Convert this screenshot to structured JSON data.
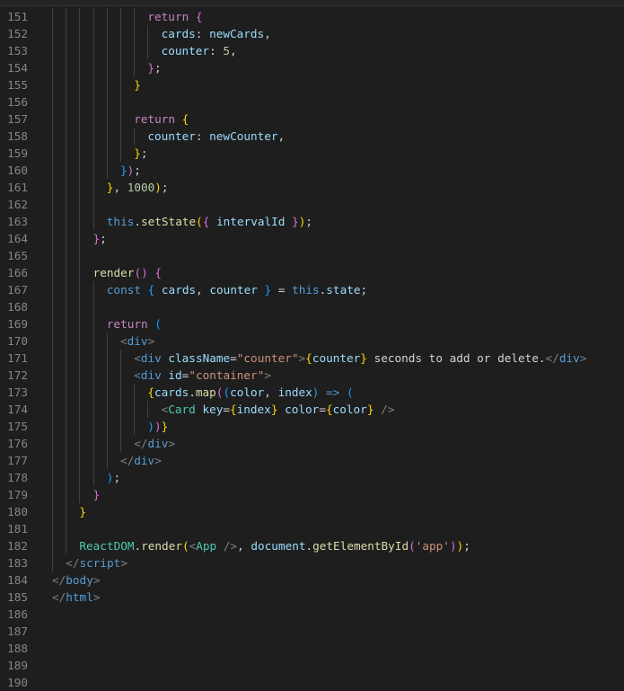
{
  "editor": {
    "first_line": 151,
    "lines": [
      {
        "n": "151",
        "indent": 7,
        "t": [
          [
            "kw",
            "return"
          ],
          [
            "txt",
            " "
          ],
          [
            "b2",
            "{"
          ]
        ]
      },
      {
        "n": "152",
        "indent": 8,
        "t": [
          [
            "prop",
            "cards"
          ],
          [
            "txt",
            ": "
          ],
          [
            "var",
            "newCards"
          ],
          [
            "txt",
            ","
          ]
        ]
      },
      {
        "n": "153",
        "indent": 8,
        "t": [
          [
            "prop",
            "counter"
          ],
          [
            "txt",
            ": "
          ],
          [
            "num",
            "5"
          ],
          [
            "txt",
            ","
          ]
        ]
      },
      {
        "n": "154",
        "indent": 7,
        "t": [
          [
            "b2",
            "}"
          ],
          [
            "txt",
            ";"
          ]
        ]
      },
      {
        "n": "155",
        "indent": 6,
        "t": [
          [
            "b1",
            "}"
          ]
        ]
      },
      {
        "n": "156",
        "indent": 0,
        "t": []
      },
      {
        "n": "157",
        "indent": 6,
        "t": [
          [
            "kw",
            "return"
          ],
          [
            "txt",
            " "
          ],
          [
            "b1",
            "{"
          ]
        ]
      },
      {
        "n": "158",
        "indent": 7,
        "t": [
          [
            "prop",
            "counter"
          ],
          [
            "txt",
            ": "
          ],
          [
            "var",
            "newCounter"
          ],
          [
            "txt",
            ","
          ]
        ]
      },
      {
        "n": "159",
        "indent": 6,
        "t": [
          [
            "b1",
            "}"
          ],
          [
            "txt",
            ";"
          ]
        ]
      },
      {
        "n": "160",
        "indent": 5,
        "t": [
          [
            "b3",
            "}"
          ],
          [
            "b2",
            ")"
          ],
          [
            "txt",
            ";"
          ]
        ]
      },
      {
        "n": "161",
        "indent": 4,
        "t": [
          [
            "b1",
            "}"
          ],
          [
            "txt",
            ", "
          ],
          [
            "num",
            "1000"
          ],
          [
            "b1",
            ")"
          ],
          [
            "txt",
            ";"
          ]
        ]
      },
      {
        "n": "162",
        "indent": 0,
        "t": []
      },
      {
        "n": "163",
        "indent": 4,
        "t": [
          [
            "this",
            "this"
          ],
          [
            "txt",
            "."
          ],
          [
            "fn",
            "setState"
          ],
          [
            "b1",
            "("
          ],
          [
            "b2",
            "{"
          ],
          [
            "txt",
            " "
          ],
          [
            "var",
            "intervalId"
          ],
          [
            "txt",
            " "
          ],
          [
            "b2",
            "}"
          ],
          [
            "b1",
            ")"
          ],
          [
            "txt",
            ";"
          ]
        ]
      },
      {
        "n": "164",
        "indent": 3,
        "t": [
          [
            "b2",
            "}"
          ],
          [
            "txt",
            ";"
          ]
        ]
      },
      {
        "n": "165",
        "indent": 0,
        "t": []
      },
      {
        "n": "166",
        "indent": 3,
        "t": [
          [
            "fn",
            "render"
          ],
          [
            "b2",
            "()"
          ],
          [
            "txt",
            " "
          ],
          [
            "b2",
            "{"
          ]
        ]
      },
      {
        "n": "167",
        "indent": 4,
        "t": [
          [
            "this",
            "const"
          ],
          [
            "txt",
            " "
          ],
          [
            "b3",
            "{"
          ],
          [
            "txt",
            " "
          ],
          [
            "var",
            "cards"
          ],
          [
            "txt",
            ", "
          ],
          [
            "var",
            "counter"
          ],
          [
            "txt",
            " "
          ],
          [
            "b3",
            "}"
          ],
          [
            "txt",
            " = "
          ],
          [
            "this",
            "this"
          ],
          [
            "txt",
            "."
          ],
          [
            "var",
            "state"
          ],
          [
            "txt",
            ";"
          ]
        ]
      },
      {
        "n": "168",
        "indent": 0,
        "t": []
      },
      {
        "n": "169",
        "indent": 4,
        "t": [
          [
            "kw",
            "return"
          ],
          [
            "txt",
            " "
          ],
          [
            "b3",
            "("
          ]
        ]
      },
      {
        "n": "170",
        "indent": 5,
        "t": [
          [
            "tagp",
            "<"
          ],
          [
            "tag",
            "div"
          ],
          [
            "tagp",
            ">"
          ]
        ]
      },
      {
        "n": "171",
        "indent": 6,
        "t": [
          [
            "tagp",
            "<"
          ],
          [
            "tag",
            "div"
          ],
          [
            "txt",
            " "
          ],
          [
            "attr",
            "className"
          ],
          [
            "txt",
            "="
          ],
          [
            "str",
            "\"counter\""
          ],
          [
            "tagp",
            ">"
          ],
          [
            "b1",
            "{"
          ],
          [
            "var",
            "counter"
          ],
          [
            "b1",
            "}"
          ],
          [
            "txt",
            " seconds to add or delete."
          ],
          [
            "tagp",
            "</"
          ],
          [
            "tag",
            "div"
          ],
          [
            "tagp",
            ">"
          ]
        ]
      },
      {
        "n": "172",
        "indent": 6,
        "t": [
          [
            "tagp",
            "<"
          ],
          [
            "tag",
            "div"
          ],
          [
            "txt",
            " "
          ],
          [
            "attr",
            "id"
          ],
          [
            "txt",
            "="
          ],
          [
            "str",
            "\"container\""
          ],
          [
            "tagp",
            ">"
          ]
        ]
      },
      {
        "n": "173",
        "indent": 7,
        "t": [
          [
            "b1",
            "{"
          ],
          [
            "var",
            "cards"
          ],
          [
            "txt",
            "."
          ],
          [
            "fn",
            "map"
          ],
          [
            "b2",
            "("
          ],
          [
            "b3",
            "("
          ],
          [
            "var",
            "color"
          ],
          [
            "txt",
            ", "
          ],
          [
            "var",
            "index"
          ],
          [
            "b3",
            ")"
          ],
          [
            "txt",
            " "
          ],
          [
            "this",
            "=>"
          ],
          [
            "txt",
            " "
          ],
          [
            "b3",
            "("
          ]
        ]
      },
      {
        "n": "174",
        "indent": 8,
        "t": [
          [
            "tagp",
            "<"
          ],
          [
            "comp",
            "Card"
          ],
          [
            "txt",
            " "
          ],
          [
            "attr",
            "key"
          ],
          [
            "txt",
            "="
          ],
          [
            "b1",
            "{"
          ],
          [
            "var",
            "index"
          ],
          [
            "b1",
            "}"
          ],
          [
            "txt",
            " "
          ],
          [
            "attr",
            "color"
          ],
          [
            "txt",
            "="
          ],
          [
            "b1",
            "{"
          ],
          [
            "var",
            "color"
          ],
          [
            "b1",
            "}"
          ],
          [
            "txt",
            " "
          ],
          [
            "tagp",
            "/>"
          ]
        ]
      },
      {
        "n": "175",
        "indent": 7,
        "t": [
          [
            "b3",
            ")"
          ],
          [
            "b2",
            ")"
          ],
          [
            "b1",
            "}"
          ]
        ]
      },
      {
        "n": "176",
        "indent": 6,
        "t": [
          [
            "tagp",
            "</"
          ],
          [
            "tag",
            "div"
          ],
          [
            "tagp",
            ">"
          ]
        ]
      },
      {
        "n": "177",
        "indent": 5,
        "t": [
          [
            "tagp",
            "</"
          ],
          [
            "tag",
            "div"
          ],
          [
            "tagp",
            ">"
          ]
        ]
      },
      {
        "n": "178",
        "indent": 4,
        "t": [
          [
            "b3",
            ")"
          ],
          [
            "txt",
            ";"
          ]
        ]
      },
      {
        "n": "179",
        "indent": 3,
        "t": [
          [
            "b2",
            "}"
          ]
        ]
      },
      {
        "n": "180",
        "indent": 2,
        "t": [
          [
            "b1",
            "}"
          ]
        ]
      },
      {
        "n": "181",
        "indent": 0,
        "t": []
      },
      {
        "n": "182",
        "indent": 2,
        "t": [
          [
            "comp",
            "ReactDOM"
          ],
          [
            "txt",
            "."
          ],
          [
            "fn",
            "render"
          ],
          [
            "b1",
            "("
          ],
          [
            "tagp",
            "<"
          ],
          [
            "comp",
            "App"
          ],
          [
            "txt",
            " "
          ],
          [
            "tagp",
            "/>"
          ],
          [
            "txt",
            ", "
          ],
          [
            "var",
            "document"
          ],
          [
            "txt",
            "."
          ],
          [
            "fn",
            "getElementById"
          ],
          [
            "b2",
            "("
          ],
          [
            "str",
            "'app'"
          ],
          [
            "b2",
            ")"
          ],
          [
            "b1",
            ")"
          ],
          [
            "txt",
            ";"
          ]
        ]
      },
      {
        "n": "183",
        "indent": 1,
        "t": [
          [
            "tagp",
            "</"
          ],
          [
            "tag",
            "script"
          ],
          [
            "tagp",
            ">"
          ]
        ]
      },
      {
        "n": "184",
        "indent": 0,
        "t": [
          [
            "tagp",
            "</"
          ],
          [
            "tag",
            "body"
          ],
          [
            "tagp",
            ">"
          ]
        ]
      },
      {
        "n": "185",
        "indent": 0,
        "t": [
          [
            "tagp",
            "</"
          ],
          [
            "tag",
            "html"
          ],
          [
            "tagp",
            ">"
          ]
        ]
      },
      {
        "n": "186",
        "indent": 0,
        "t": []
      },
      {
        "n": "187",
        "indent": 0,
        "t": []
      },
      {
        "n": "188",
        "indent": 0,
        "t": []
      },
      {
        "n": "189",
        "indent": 0,
        "t": []
      },
      {
        "n": "190",
        "indent": 0,
        "t": []
      }
    ]
  },
  "colors": {
    "background": "#1e1e1e",
    "line_number": "#858585",
    "keyword": "#c586c0",
    "variable": "#9cdcfe",
    "number": "#b5cea8",
    "function": "#dcdcaa",
    "storage": "#569cd6",
    "string": "#ce9178",
    "component": "#4ec9b0"
  }
}
